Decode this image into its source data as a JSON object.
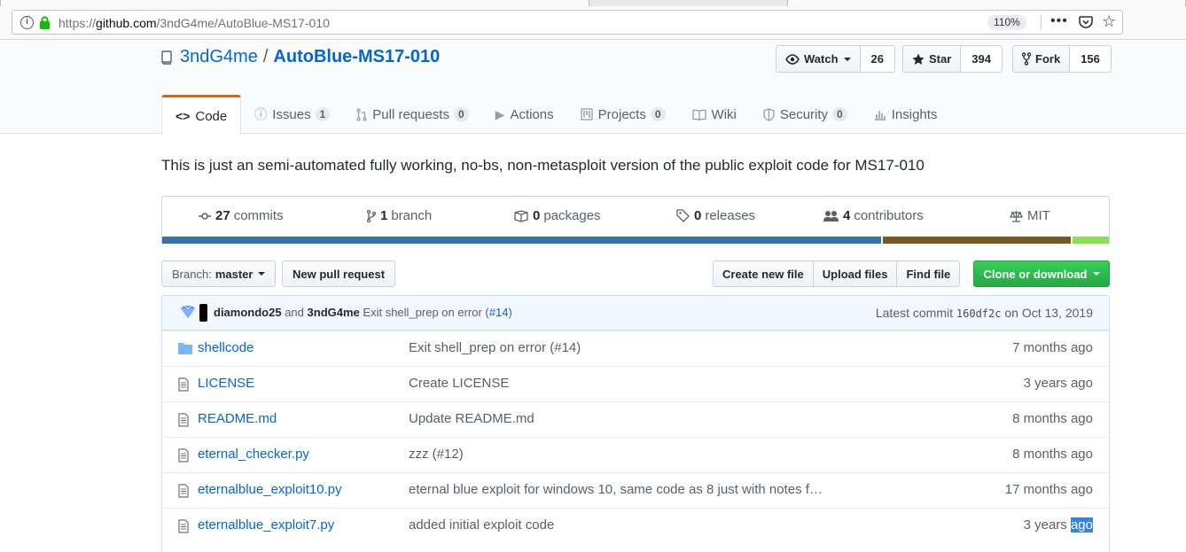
{
  "browser": {
    "url_prefix": "https://",
    "url_domain": "github.com",
    "url_path": "/3ndG4me/AutoBlue-MS17-010",
    "zoom": "110%"
  },
  "repo": {
    "owner": "3ndG4me",
    "separator": "/",
    "name": "AutoBlue-MS17-010",
    "actions": {
      "watch_label": "Watch",
      "watch_count": "26",
      "star_label": "Star",
      "star_count": "394",
      "fork_label": "Fork",
      "fork_count": "156"
    },
    "nav": [
      {
        "label": "Code",
        "icon": "code-icon"
      },
      {
        "label": "Issues",
        "count": "1",
        "icon": "issue-icon"
      },
      {
        "label": "Pull requests",
        "count": "0",
        "icon": "pull-request-icon"
      },
      {
        "label": "Actions",
        "icon": "play-icon"
      },
      {
        "label": "Projects",
        "count": "0",
        "icon": "project-icon"
      },
      {
        "label": "Wiki",
        "icon": "book-icon"
      },
      {
        "label": "Security",
        "count": "0",
        "icon": "shield-icon"
      },
      {
        "label": "Insights",
        "icon": "graph-icon"
      }
    ],
    "description": "This is just an semi-automated fully working, no-bs, non-metasploit version of the public exploit code for MS17-010"
  },
  "summary": {
    "commits_count": "27",
    "commits_label": "commits",
    "branch_count": "1",
    "branch_label": "branch",
    "packages_count": "0",
    "packages_label": "packages",
    "releases_count": "0",
    "releases_label": "releases",
    "contributors_count": "4",
    "contributors_label": "contributors",
    "license": "MIT",
    "language_colors": [
      "#3572A5",
      "#785a1e",
      "#89e051"
    ],
    "language_shares": [
      0.759,
      0.201,
      0.04
    ]
  },
  "filenav": {
    "branch_label": "Branch:",
    "branch_value": "master",
    "new_pr": "New pull request",
    "create_file": "Create new file",
    "upload_files": "Upload files",
    "find_file": "Find file",
    "clone": "Clone or download"
  },
  "commit": {
    "author": "diamondo25",
    "and": "and",
    "coauthor": "3ndG4me",
    "message": "Exit shell_prep on error (",
    "pr": "#14",
    "message_end": ")",
    "latest_label": "Latest commit",
    "sha": "160df2c",
    "date": "on Oct 13, 2019"
  },
  "files": [
    {
      "type": "dir",
      "name": "shellcode",
      "message": "Exit shell_prep on error (#14)",
      "age": "7 months ago"
    },
    {
      "type": "file",
      "name": "LICENSE",
      "message": "Create LICENSE",
      "age": "3 years ago"
    },
    {
      "type": "file",
      "name": "README.md",
      "message": "Update README.md",
      "age": "8 months ago"
    },
    {
      "type": "file",
      "name": "eternal_checker.py",
      "message": "zzz (#12)",
      "age": "8 months ago"
    },
    {
      "type": "file",
      "name": "eternalblue_exploit10.py",
      "message": "eternal blue exploit for windows 10, same code as 8 just with notes f…",
      "age": "17 months ago"
    },
    {
      "type": "file",
      "name": "eternalblue_exploit7.py",
      "message": "added initial exploit code",
      "age_a": "3 years ",
      "age_b": "ago"
    }
  ]
}
